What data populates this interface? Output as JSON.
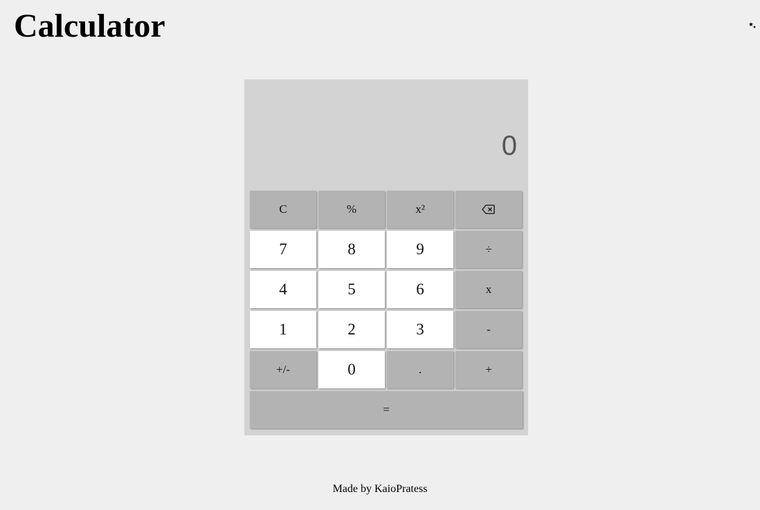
{
  "header": {
    "title": "Calculator",
    "theme_toggle_icon": "moon-stars-icon"
  },
  "display": {
    "value": "0"
  },
  "keypad": {
    "row1": {
      "clear": "C",
      "percent": "%",
      "square": "x²",
      "backspace_icon": "backspace-icon"
    },
    "row2": {
      "seven": "7",
      "eight": "8",
      "nine": "9",
      "divide": "÷"
    },
    "row3": {
      "four": "4",
      "five": "5",
      "six": "6",
      "multiply": "x"
    },
    "row4": {
      "one": "1",
      "two": "2",
      "three": "3",
      "subtract": "-"
    },
    "row5": {
      "negate": "+/-",
      "zero": "0",
      "decimal": ".",
      "add": "+"
    },
    "row6": {
      "equals": "="
    }
  },
  "footer": {
    "credit": "Made by KaioPratess"
  },
  "colors": {
    "page_background": "#efefef",
    "calculator_background": "#d3d3d3",
    "operator_key": "#b3b3b3",
    "number_key": "#ffffff",
    "display_text": "#555555"
  }
}
